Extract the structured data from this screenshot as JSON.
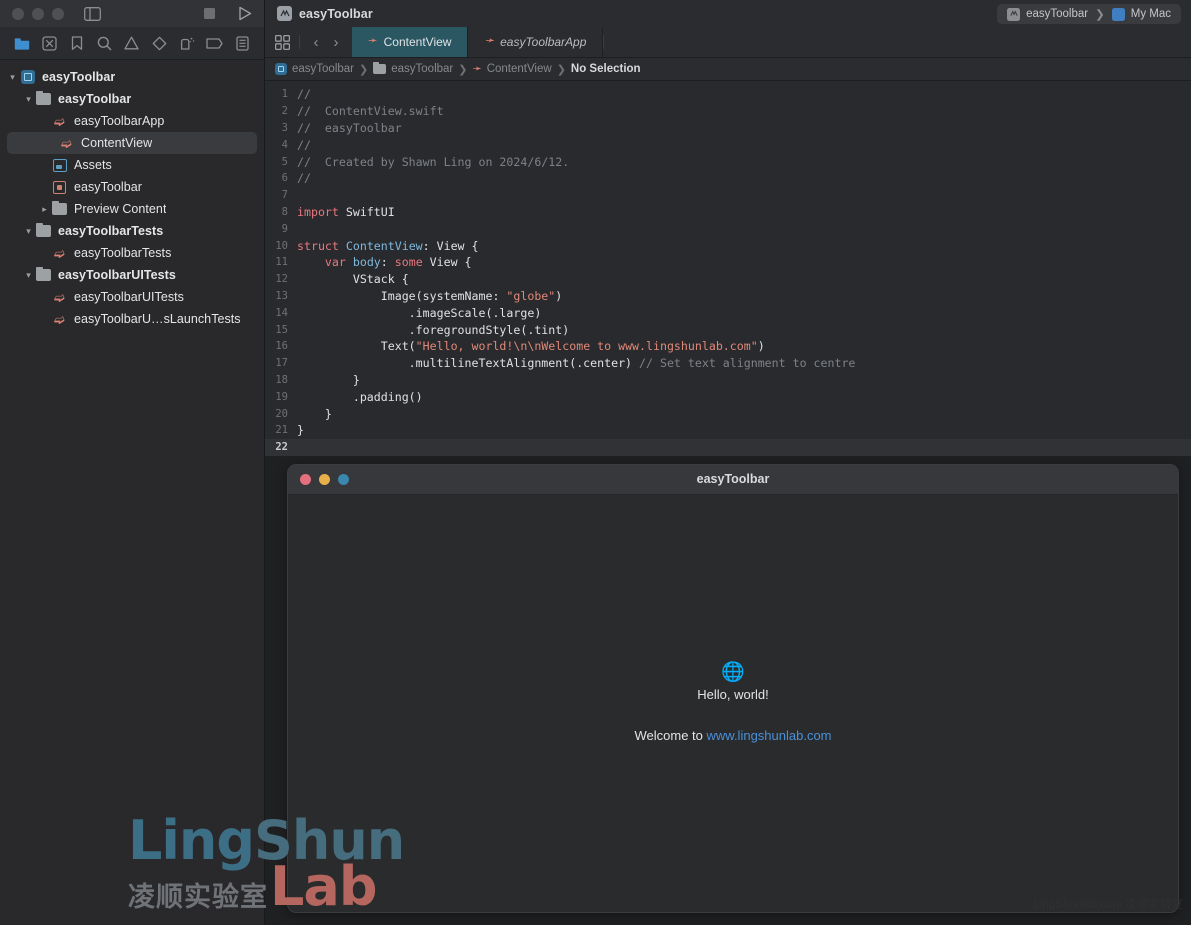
{
  "window": {
    "title": "easyToolbar",
    "project_icon": "xcode-project-icon",
    "traffic_lights": [
      "close",
      "minimize",
      "zoom"
    ],
    "sidebar_toggle_icon": "sidebar-toggle-icon",
    "stop_icon": "stop-button-icon",
    "run_icon": "run-button-icon"
  },
  "scheme": {
    "target": "easyToolbar",
    "separator": "❯",
    "destination": "My Mac",
    "target_icon": "scheme-target-icon",
    "destination_icon": "my-mac-icon"
  },
  "navigator": {
    "tabs": [
      {
        "name": "project-navigator-tab",
        "icon": "folder-icon",
        "active": true
      },
      {
        "name": "source-control-navigator-tab",
        "icon": "source-control-icon",
        "active": false
      },
      {
        "name": "bookmark-navigator-tab",
        "icon": "bookmark-icon",
        "active": false
      },
      {
        "name": "find-navigator-tab",
        "icon": "search-icon",
        "active": false
      },
      {
        "name": "issue-navigator-tab",
        "icon": "warning-triangle-icon",
        "active": false
      },
      {
        "name": "test-navigator-tab",
        "icon": "diamond-icon",
        "active": false
      },
      {
        "name": "debug-navigator-tab",
        "icon": "debug-gauge-icon",
        "active": false
      },
      {
        "name": "breakpoint-navigator-tab",
        "icon": "breakpoint-tag-icon",
        "active": false
      },
      {
        "name": "report-navigator-tab",
        "icon": "report-list-icon",
        "active": false
      }
    ],
    "tree": [
      {
        "label": "easyToolbar",
        "icon": "project",
        "indent": 0,
        "chevron": "down",
        "selected": false,
        "bold": true
      },
      {
        "label": "easyToolbar",
        "icon": "folder",
        "indent": 1,
        "chevron": "down",
        "selected": false,
        "bold": true
      },
      {
        "label": "easyToolbarApp",
        "icon": "swift",
        "indent": 2,
        "chevron": "none",
        "selected": false,
        "bold": false
      },
      {
        "label": "ContentView",
        "icon": "swift",
        "indent": 2,
        "chevron": "none",
        "selected": true,
        "bold": false
      },
      {
        "label": "Assets",
        "icon": "assets",
        "indent": 2,
        "chevron": "none",
        "selected": false,
        "bold": false
      },
      {
        "label": "easyToolbar",
        "icon": "entitle",
        "indent": 2,
        "chevron": "none",
        "selected": false,
        "bold": false
      },
      {
        "label": "Preview Content",
        "icon": "folder",
        "indent": 2,
        "chevron": "right",
        "selected": false,
        "bold": false
      },
      {
        "label": "easyToolbarTests",
        "icon": "folder",
        "indent": 1,
        "chevron": "down",
        "selected": false,
        "bold": true
      },
      {
        "label": "easyToolbarTests",
        "icon": "swift",
        "indent": 2,
        "chevron": "none",
        "selected": false,
        "bold": false
      },
      {
        "label": "easyToolbarUITests",
        "icon": "folder",
        "indent": 1,
        "chevron": "down",
        "selected": false,
        "bold": true
      },
      {
        "label": "easyToolbarUITests",
        "icon": "swift",
        "indent": 2,
        "chevron": "none",
        "selected": false,
        "bold": false
      },
      {
        "label": "easyToolbarU…sLaunchTests",
        "icon": "swift",
        "indent": 2,
        "chevron": "none",
        "selected": false,
        "bold": false
      }
    ]
  },
  "editor": {
    "grid_icon": "editor-options-grid-icon",
    "back_arrow": "‹",
    "forward_arrow": "›",
    "tabs": [
      {
        "label": "ContentView",
        "icon": "swift-file-icon",
        "active": true,
        "italic": false
      },
      {
        "label": "easyToolbarApp",
        "icon": "swift-file-icon",
        "active": false,
        "italic": true
      }
    ],
    "breadcrumb": [
      {
        "label": "easyToolbar",
        "icon": "project"
      },
      {
        "label": "easyToolbar",
        "icon": "folder"
      },
      {
        "label": "ContentView",
        "icon": "swift"
      },
      {
        "label": "No Selection",
        "icon": "none"
      }
    ],
    "breadcrumb_separator": "❯",
    "current_line": 22,
    "code_lines": [
      {
        "n": 1,
        "tokens": [
          {
            "t": "//",
            "c": "c"
          }
        ]
      },
      {
        "n": 2,
        "tokens": [
          {
            "t": "//  ContentView.swift",
            "c": "c"
          }
        ]
      },
      {
        "n": 3,
        "tokens": [
          {
            "t": "//  easyToolbar",
            "c": "c"
          }
        ]
      },
      {
        "n": 4,
        "tokens": [
          {
            "t": "//",
            "c": "c"
          }
        ]
      },
      {
        "n": 5,
        "tokens": [
          {
            "t": "//  Created by Shawn Ling on 2024/6/12.",
            "c": "c"
          }
        ]
      },
      {
        "n": 6,
        "tokens": [
          {
            "t": "//",
            "c": "c"
          }
        ]
      },
      {
        "n": 7,
        "tokens": [
          {
            "t": "",
            "c": "f"
          }
        ]
      },
      {
        "n": 8,
        "tokens": [
          {
            "t": "import",
            "c": "k"
          },
          {
            "t": " SwiftUI",
            "c": "f"
          }
        ]
      },
      {
        "n": 9,
        "tokens": [
          {
            "t": "",
            "c": "f"
          }
        ]
      },
      {
        "n": 10,
        "tokens": [
          {
            "t": "struct",
            "c": "k"
          },
          {
            "t": " ",
            "c": "f"
          },
          {
            "t": "ContentView",
            "c": "t"
          },
          {
            "t": ": View {",
            "c": "f"
          }
        ]
      },
      {
        "n": 11,
        "tokens": [
          {
            "t": "    ",
            "c": "f"
          },
          {
            "t": "var",
            "c": "k"
          },
          {
            "t": " ",
            "c": "f"
          },
          {
            "t": "body",
            "c": "t"
          },
          {
            "t": ": ",
            "c": "f"
          },
          {
            "t": "some",
            "c": "k"
          },
          {
            "t": " View {",
            "c": "f"
          }
        ]
      },
      {
        "n": 12,
        "tokens": [
          {
            "t": "        VStack {",
            "c": "f"
          }
        ]
      },
      {
        "n": 13,
        "tokens": [
          {
            "t": "            Image(systemName: ",
            "c": "f"
          },
          {
            "t": "\"globe\"",
            "c": "s"
          },
          {
            "t": ")",
            "c": "f"
          }
        ]
      },
      {
        "n": 14,
        "tokens": [
          {
            "t": "                .imageScale(.large)",
            "c": "f"
          }
        ]
      },
      {
        "n": 15,
        "tokens": [
          {
            "t": "                .foregroundStyle(.tint)",
            "c": "f"
          }
        ]
      },
      {
        "n": 16,
        "tokens": [
          {
            "t": "            Text(",
            "c": "f"
          },
          {
            "t": "\"Hello, world!\\n\\nWelcome to www.lingshunlab.com\"",
            "c": "s"
          },
          {
            "t": ")",
            "c": "f"
          }
        ]
      },
      {
        "n": 17,
        "tokens": [
          {
            "t": "                .multilineTextAlignment(.center) ",
            "c": "f"
          },
          {
            "t": "// Set text alignment to centre",
            "c": "c"
          }
        ]
      },
      {
        "n": 18,
        "tokens": [
          {
            "t": "        }",
            "c": "f"
          }
        ]
      },
      {
        "n": 19,
        "tokens": [
          {
            "t": "        .padding()",
            "c": "f"
          }
        ]
      },
      {
        "n": 20,
        "tokens": [
          {
            "t": "    }",
            "c": "f"
          }
        ]
      },
      {
        "n": 21,
        "tokens": [
          {
            "t": "}",
            "c": "f"
          }
        ]
      },
      {
        "n": 22,
        "tokens": [
          {
            "t": "",
            "c": "f"
          }
        ]
      }
    ]
  },
  "preview": {
    "window_title": "easyToolbar",
    "traffic_lights": [
      "close",
      "minimize",
      "zoom"
    ],
    "globe_icon": "globe-icon",
    "hello_text": "Hello, world!",
    "welcome_prefix": "Welcome to ",
    "welcome_url": "www.lingshunlab.com"
  },
  "watermark": {
    "line1_a": "Ling",
    "line1_b": "Shun",
    "chinese": "凌顺实验室",
    "lab": "Lab",
    "bottom_right": "LingShunlab.com 凌顺实验室"
  },
  "colors": {
    "accent_teal": "#2b5763",
    "keyword_red": "#e8777f",
    "type_blue": "#7fb8dd",
    "string_salmon": "#e08878",
    "comment_gray": "#7e8287",
    "nav_active_blue": "#3f8fd0",
    "link_blue": "#4a90d9"
  }
}
